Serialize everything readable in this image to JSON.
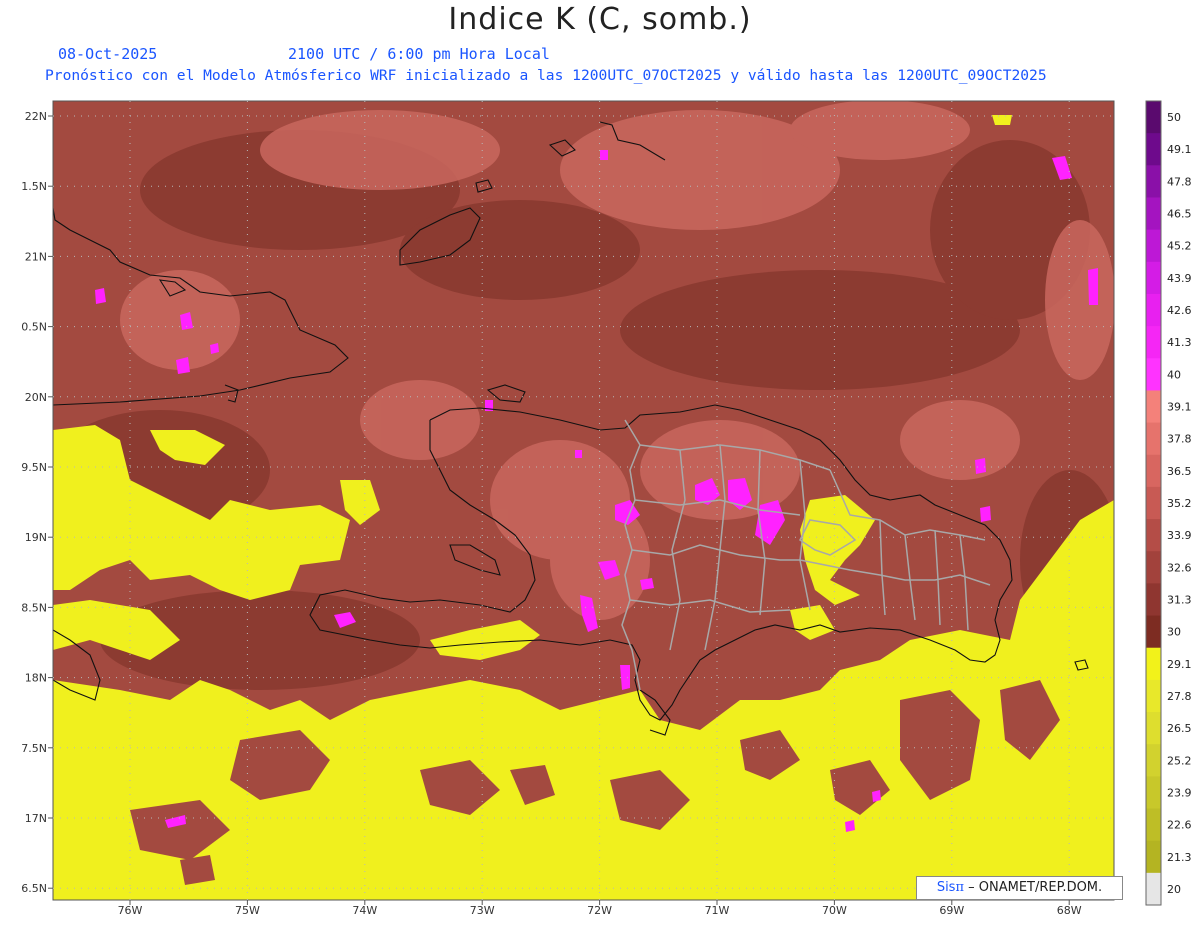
{
  "header": {
    "title": "Indice K (C, somb.)",
    "date": "08-Oct-2025",
    "time": "2100 UTC / 6:00 pm Hora Local",
    "forecast": "Pronóstico con el Modelo Atmósferico WRF inicializado a las 1200UTC_07OCT2025 y válido hasta las  1200UTC_09OCT2025"
  },
  "axes": {
    "lat_labels": [
      "22N",
      "1.5N",
      "21N",
      "0.5N",
      "20N",
      "9.5N",
      "19N",
      "8.5N",
      "18N",
      "7.5N",
      "17N",
      "6.5N"
    ],
    "lon_labels": [
      "76W",
      "75W",
      "74W",
      "73W",
      "72W",
      "71W",
      "70W",
      "69W",
      "68W"
    ]
  },
  "colorbar": {
    "levels": [
      "50",
      "49.1",
      "47.8",
      "46.5",
      "45.2",
      "43.9",
      "42.6",
      "41.3",
      "40",
      "39.1",
      "37.8",
      "36.5",
      "35.2",
      "33.9",
      "32.6",
      "31.3",
      "30",
      "29.1",
      "27.8",
      "26.5",
      "25.2",
      "23.9",
      "22.6",
      "21.3",
      "20"
    ],
    "colors": [
      "#5a0a6e",
      "#6e0a8c",
      "#8a10a8",
      "#a414c0",
      "#bd18d6",
      "#d41ce6",
      "#e820f0",
      "#f526f5",
      "#ff33ff",
      "#f4817a",
      "#e6736c",
      "#d86660",
      "#c85a54",
      "#b44d47",
      "#a2423c",
      "#8f3630",
      "#7d2c22",
      "#f2f21a",
      "#e8e82a",
      "#dede2e",
      "#d2d22e",
      "#c8c82a",
      "#bebe26",
      "#b4b422",
      "#e6e6e6"
    ]
  },
  "credit": {
    "sis": "Sis",
    "pi": "π",
    "org": "– ONAMET/REP.DOM."
  }
}
